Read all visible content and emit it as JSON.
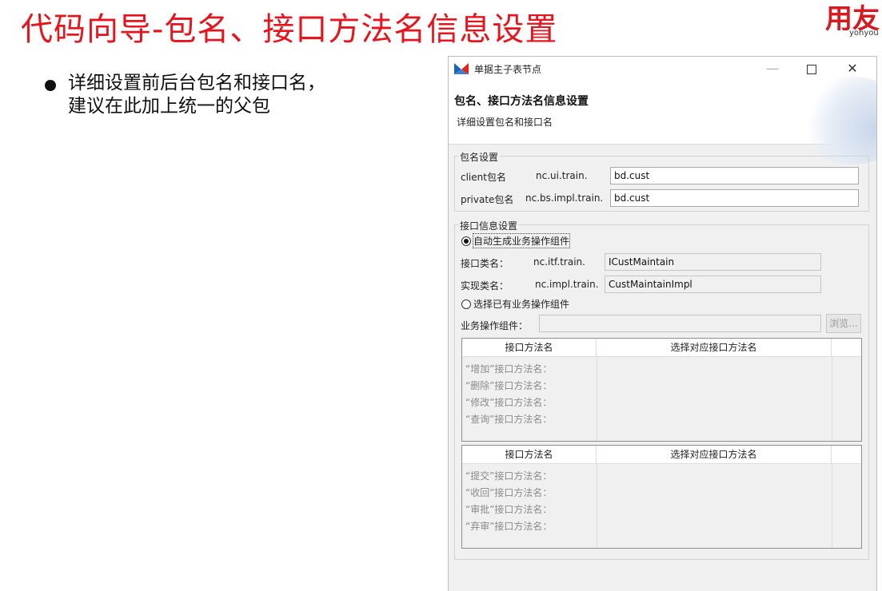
{
  "slide": {
    "title": "代码向导-包名、接口方法名信息设置",
    "logo_main": "用友",
    "logo_sub": "yonyou",
    "bullet": "详细设置前后台包名和接口名，\n建议在此加上统一的父包"
  },
  "dialog": {
    "window_title": "单据主子表节点",
    "controls": {
      "minimize": "—",
      "close": "✕"
    },
    "header_title": "包名、接口方法名信息设置",
    "header_subtitle": "详细设置包名和接口名",
    "package": {
      "group_label": "包名设置",
      "client_label": "client包名",
      "client_prefix": "nc.ui.train.",
      "client_value": "bd.cust",
      "private_label": "private包名",
      "private_prefix": "nc.bs.impl.train.",
      "private_value": "bd.cust"
    },
    "interface": {
      "group_label": "接口信息设置",
      "radio_auto": "自动生成业务操作组件",
      "iface_label": "接口类名：",
      "iface_prefix": "nc.itf.train.",
      "iface_value": "ICustMaintain",
      "impl_label": "实现类名：",
      "impl_prefix": "nc.impl.train.",
      "impl_value": "CustMaintainImpl",
      "radio_existing": "选择已有业务操作组件",
      "component_label": "业务操作组件：",
      "component_value": "",
      "browse_label": "浏览..."
    },
    "table1": {
      "headers": [
        "接口方法名",
        "选择对应接口方法名"
      ],
      "rows": [
        "“增加”接口方法名：",
        "“删除”接口方法名：",
        "“修改”接口方法名：",
        "“查询”接口方法名："
      ]
    },
    "table2": {
      "headers": [
        "接口方法名",
        "选择对应接口方法名"
      ],
      "rows": [
        "“提交”接口方法名：",
        "“收回”接口方法名：",
        "“审批”接口方法名：",
        "“弃审”接口方法名："
      ]
    }
  },
  "colors": {
    "title_red": "#e8141d",
    "logo_red": "#d71920",
    "icon_blue": "#1d64b8",
    "icon_red": "#e2231a"
  }
}
